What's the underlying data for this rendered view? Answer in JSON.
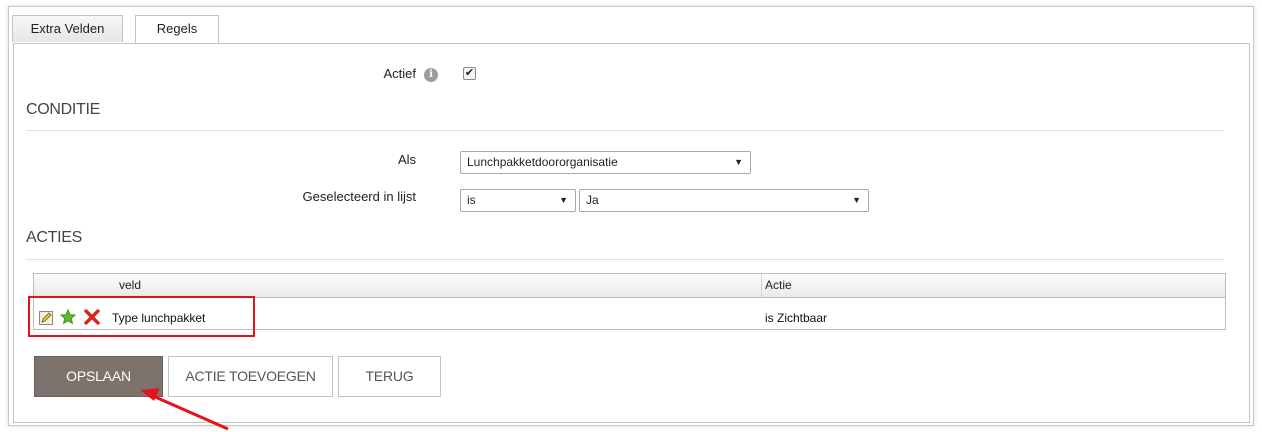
{
  "tabs": [
    {
      "label": "Extra Velden"
    },
    {
      "label": "Regels"
    }
  ],
  "form": {
    "actief_label": "Actief",
    "actief_checked": true,
    "conditie_title": "CONDITIE",
    "als_label": "Als",
    "als_value": "Lunchpakketdoororganisatie",
    "geselecteerd_label": "Geselecteerd in lijst",
    "operator_value": "is",
    "value_select": "Ja",
    "acties_title": "ACTIES"
  },
  "table": {
    "columns": [
      "veld",
      "Actie"
    ],
    "rows": [
      {
        "veld": "Type lunchpakket",
        "actie": "is Zichtbaar"
      }
    ]
  },
  "buttons": {
    "save": "OPSLAAN",
    "add_action": "ACTIE TOEVOEGEN",
    "back": "TERUG"
  },
  "icons": {
    "info": "info-icon",
    "edit": "edit-icon",
    "star": "star-icon",
    "delete": "delete-icon",
    "dropdown": "chevron-down-icon",
    "check": "checkmark-icon"
  },
  "colors": {
    "primary_button": "#7d736d",
    "annotation": "#e2141b",
    "star": "#5cb82a",
    "delete": "#d9261c"
  }
}
